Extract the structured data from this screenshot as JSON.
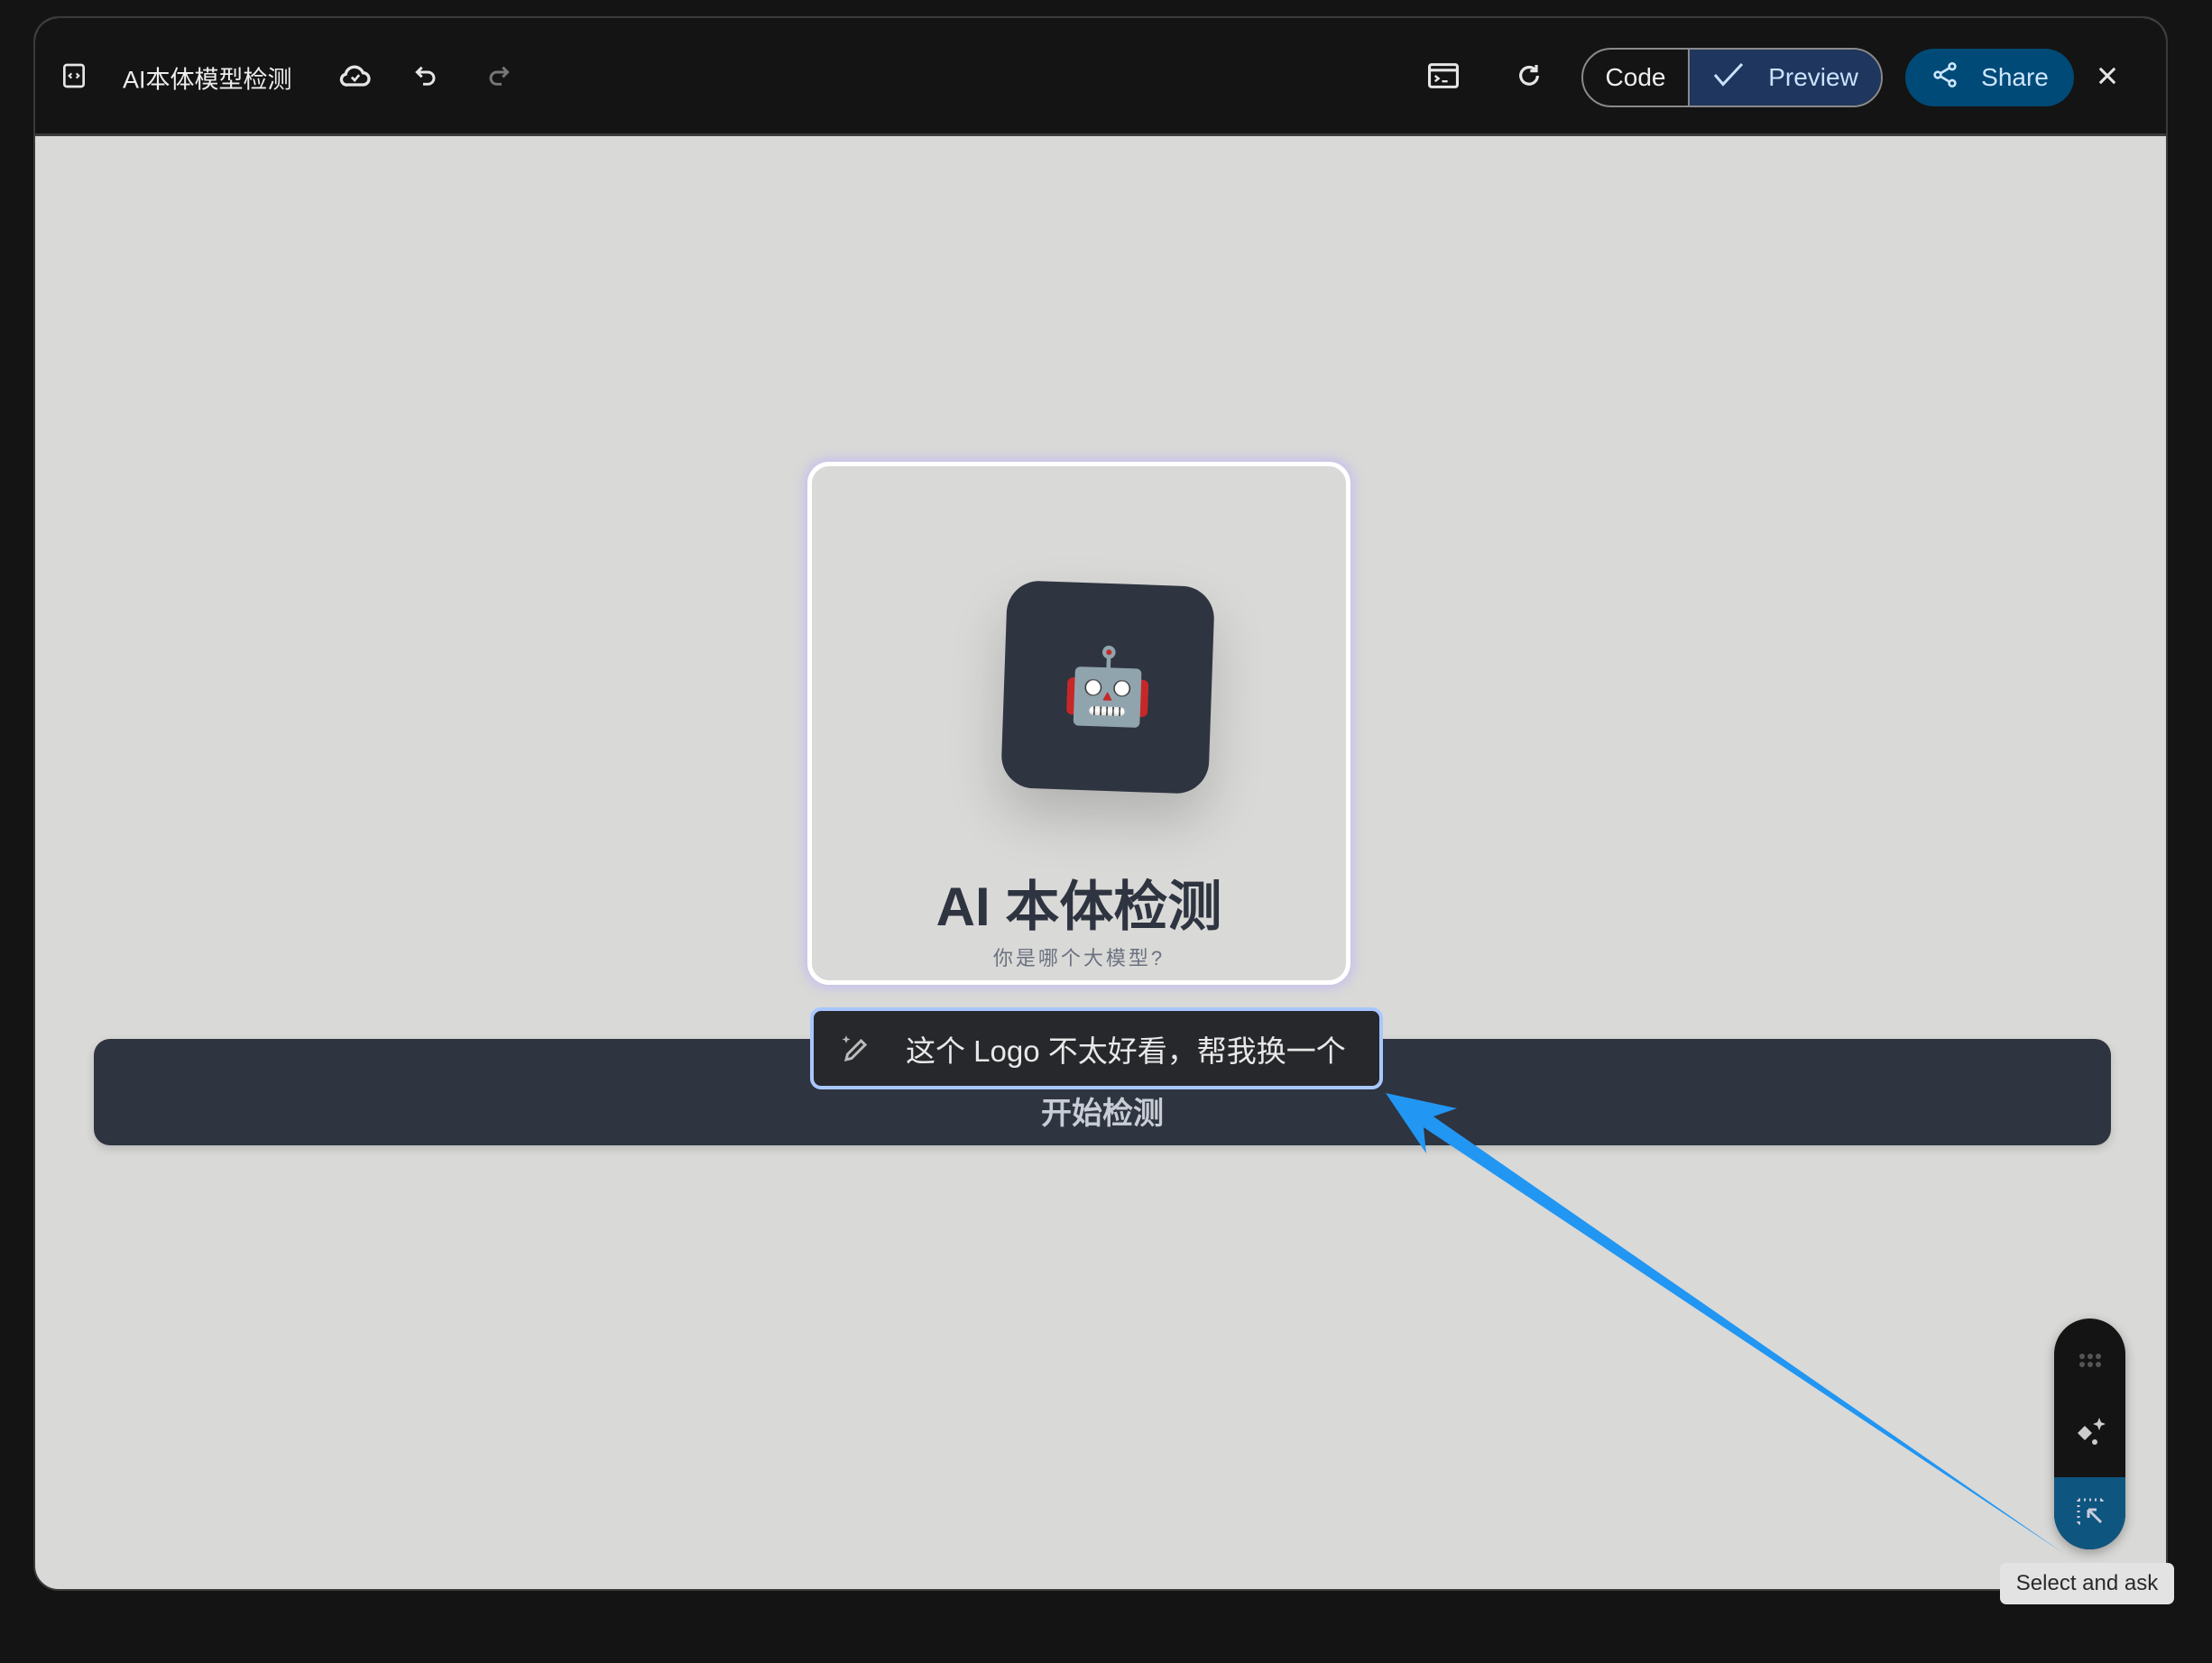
{
  "header": {
    "project_title": "AI本体模型检测",
    "icons": [
      "code-frame-icon",
      "cloud-saved-icon",
      "undo-icon",
      "redo-icon",
      "terminal-icon",
      "refresh-icon",
      "share-icon",
      "close-icon"
    ],
    "code_label": "Code",
    "preview_label": "Preview",
    "share_label": "Share"
  },
  "preview": {
    "logo_emoji": "🤖",
    "title": "AI 本体检测",
    "subtitle": "你是哪个大模型?",
    "start_button": "开始检测"
  },
  "prompt_popup": {
    "text": "这个 Logo 不太好看，帮我换一个"
  },
  "floating_toolbar": {
    "tooltip": "Select and ask"
  },
  "colors": {
    "accent": "#004a77",
    "preview_active": "#1f365e",
    "annotation_arrow": "#2196f3",
    "select_active": "#0e5680"
  }
}
